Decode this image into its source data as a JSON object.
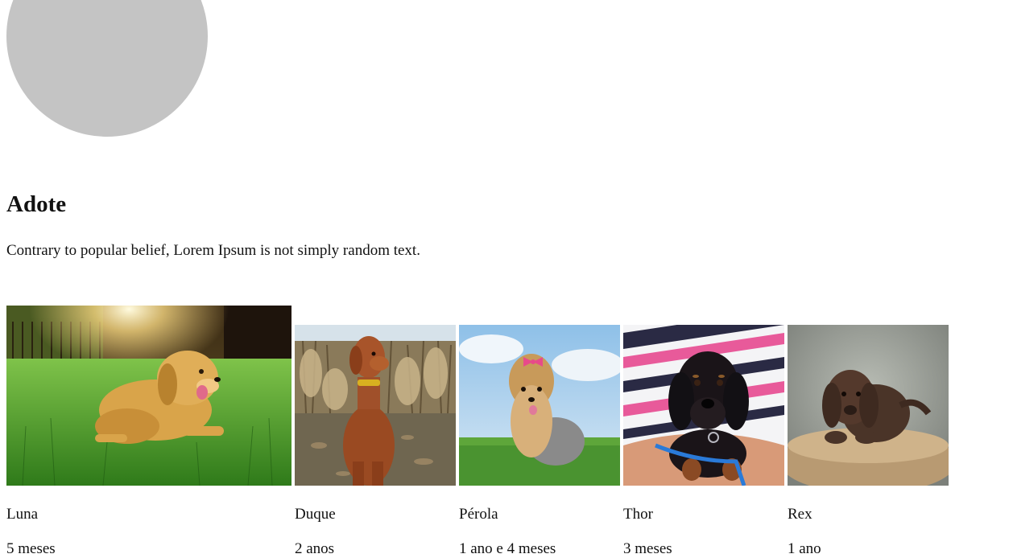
{
  "page": {
    "title": "Adote",
    "description": "Contrary to popular belief, Lorem Ipsum is not simply random text."
  },
  "pets": [
    {
      "name": "Luna",
      "age": "5 meses",
      "photo": "golden-retriever-on-grass"
    },
    {
      "name": "Duque",
      "age": "2 anos",
      "photo": "vizsla-sitting-in-field"
    },
    {
      "name": "Pérola",
      "age": "1 ano e 4 meses",
      "photo": "yorkshire-with-pink-bow"
    },
    {
      "name": "Thor",
      "age": "3 meses",
      "photo": "dachshund-puppy-in-arms"
    },
    {
      "name": "Rex",
      "age": "1 ano",
      "photo": "chocolate-labrador-puppy-on-cushion"
    }
  ],
  "colors": {
    "avatar": "#c4c4c4",
    "text": "#111111"
  }
}
